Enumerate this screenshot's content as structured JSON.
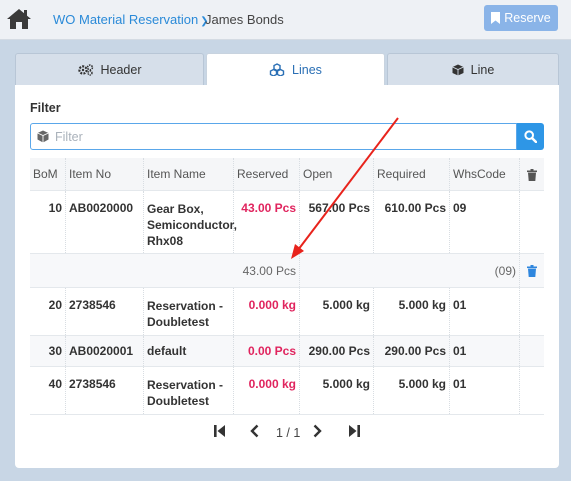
{
  "app": {
    "title": "WO Material Reservation",
    "user": "James Bonds",
    "reserve_label": "Reserve"
  },
  "tabs": [
    {
      "label": "Header",
      "icon": "gears-icon"
    },
    {
      "label": "Lines",
      "icon": "cubes-icon",
      "active": true
    },
    {
      "label": "Line",
      "icon": "cube-icon"
    }
  ],
  "filter": {
    "label": "Filter",
    "placeholder": "Filter",
    "value": ""
  },
  "table": {
    "columns": [
      "BoM",
      "Item No",
      "Item Name",
      "Reserved",
      "Open",
      "Required",
      "WhsCode"
    ],
    "rows": [
      {
        "bom": "10",
        "item_no": "AB0020000",
        "item_name": "Gear Box, Semiconductor, Rhx08",
        "reserved": "43.00 Pcs",
        "open": "567.00 Pcs",
        "required": "610.00 Pcs",
        "whs": "09"
      },
      {
        "sub_reserved": "43.00 Pcs",
        "sub_whs": "(09)"
      },
      {
        "bom": "20",
        "item_no": "2738546",
        "item_name": "Reservation - Doubletest",
        "reserved": "0.000 kg",
        "open": "5.000 kg",
        "required": "5.000 kg",
        "whs": "01"
      },
      {
        "bom": "30",
        "item_no": "AB0020001",
        "item_name": "default",
        "reserved": "0.00 Pcs",
        "open": "290.00 Pcs",
        "required": "290.00 Pcs",
        "whs": "01"
      },
      {
        "bom": "40",
        "item_no": "2738546",
        "item_name": "Reservation - Doubletest",
        "reserved": "0.000 kg",
        "open": "5.000 kg",
        "required": "5.000 kg",
        "whs": "01"
      }
    ]
  },
  "pager": {
    "text": "1 / 1"
  },
  "colors": {
    "accent": "#2e96e6",
    "reserved_red": "#e0245e",
    "annotation_arrow": "#e8231c"
  }
}
